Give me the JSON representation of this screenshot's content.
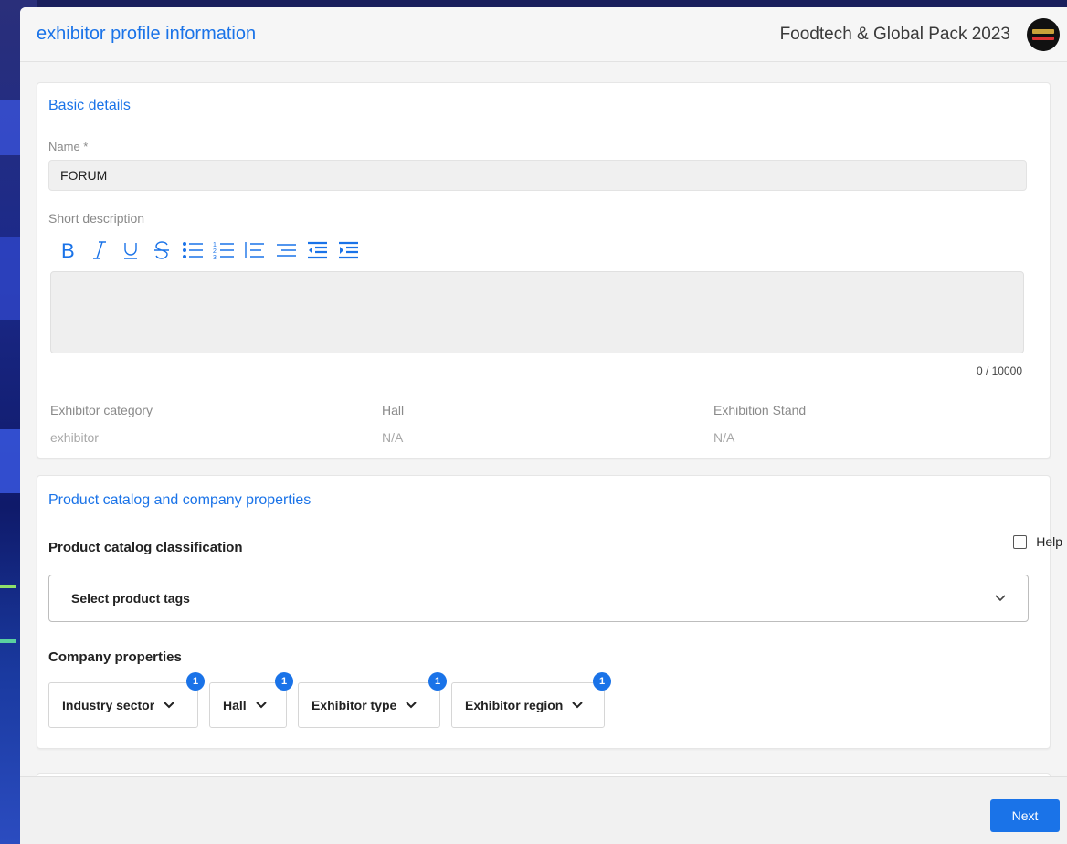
{
  "header": {
    "title": "exhibitor profile information",
    "event_name": "Foodtech & Global Pack 2023",
    "logo_icon": "event-logo-icon"
  },
  "basic": {
    "title": "Basic details",
    "name_label": "Name *",
    "name_value": "FORUM",
    "short_desc_label": "Short description",
    "char_count": "0 / 10000",
    "toolbar_icons": [
      "bold-icon",
      "italic-icon",
      "underline-icon",
      "strikethrough-icon",
      "bullet-list-icon",
      "numbered-list-icon",
      "align-left-icon",
      "align-justify-icon",
      "outdent-icon",
      "indent-icon"
    ],
    "category_label": "Exhibitor category",
    "category_value": "exhibitor",
    "hall_label": "Hall",
    "hall_value": "N/A",
    "stand_label": "Exhibition Stand",
    "stand_value": "N/A"
  },
  "catalog": {
    "title": "Product catalog and company properties",
    "classification_label": "Product catalog classification",
    "help_label": "Help",
    "tags_placeholder": "Select product tags",
    "company_props_label": "Company properties",
    "filters": [
      {
        "label": "Industry sector",
        "badge": "1"
      },
      {
        "label": "Hall",
        "badge": "1"
      },
      {
        "label": "Exhibitor type",
        "badge": "1"
      },
      {
        "label": "Exhibitor region",
        "badge": "1"
      }
    ]
  },
  "footer": {
    "next_label": "Next"
  },
  "colors": {
    "accent": "#1a73e8",
    "panel_bg": "#f4f4f4"
  }
}
